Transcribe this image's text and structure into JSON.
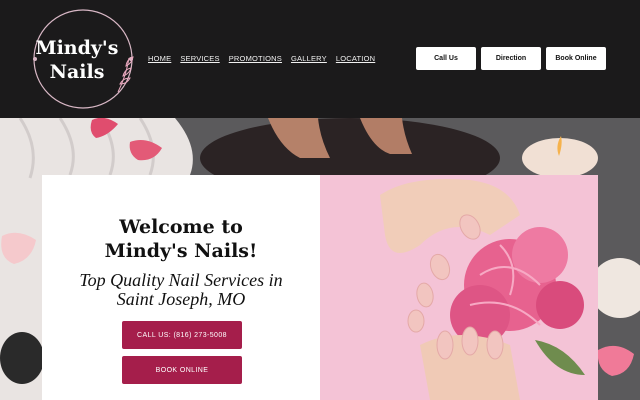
{
  "logo": {
    "line1": "Mindy's",
    "line2": "Nails"
  },
  "nav": [
    {
      "label": "HOME"
    },
    {
      "label": "SERVICES"
    },
    {
      "label": "PROMOTIONS"
    },
    {
      "label": "GALLERY"
    },
    {
      "label": "LOCATION"
    }
  ],
  "header_buttons": {
    "call": "Call Us",
    "direction": "Direction",
    "book": "Book Online"
  },
  "hero": {
    "heading_line1": "Welcome to",
    "heading_line2": "Mindy's Nails!",
    "tagline_line1": "Top Quality Nail Services in",
    "tagline_line2": "Saint Joseph, MO",
    "call_button": "CALL US: (816) 273-5008",
    "book_button": "BOOK ONLINE"
  },
  "colors": {
    "header_bg": "#1b1a1b",
    "accent": "#a51e4b",
    "photo_pink": "#f4c3d6"
  }
}
